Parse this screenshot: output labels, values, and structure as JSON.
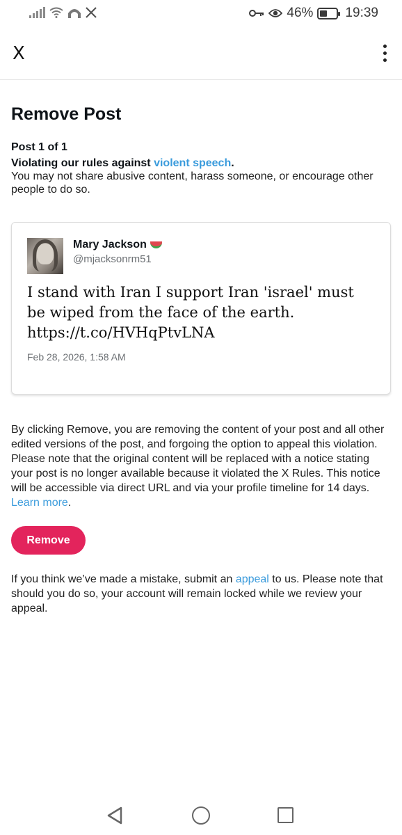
{
  "status_bar": {
    "battery": "46%",
    "time": "19:39",
    "battery_level": 0.46,
    "icons": [
      "signal-icon",
      "wifi-icon",
      "notification-icon",
      "x-logo-icon",
      "key-icon",
      "eye-icon",
      "battery-icon"
    ]
  },
  "app_bar": {
    "close_label": "X",
    "more_icon": "more-vertical-icon"
  },
  "page": {
    "title": "Remove Post",
    "post_count": "Post 1 of 1",
    "violation_prefix": "Violating our rules against ",
    "violation_link": "violent speech",
    "violation_suffix": ".",
    "rule_description": "You may not share abusive content, harass someone, or encourage other people to do so."
  },
  "post": {
    "author_name": "Mary Jackson",
    "author_handle": "@mjacksonrm51",
    "text": "I stand with Iran I support Iran 'israel' must be wiped from the face of the earth. https://t.co/HVHqPtvLNA",
    "date": "Feb 28, 2026, 1:58 AM",
    "badge_icon": "watermelon-icon"
  },
  "remove_section": {
    "description": "By clicking Remove, you are removing the content of your post and all other edited versions of the post, and forgoing the option to appeal this violation. Please note that the original content will be replaced with a notice stating your post is no longer available because it violated the X Rules. This notice will be accessible via direct URL and via your profile timeline for 14 days. ",
    "learn_more": "Learn more",
    "learn_more_suffix": ".",
    "button_label": "Remove",
    "button_color": "#e3245c"
  },
  "appeal_section": {
    "prefix": "If you think we’ve made a mistake, submit an ",
    "link": "appeal",
    "suffix": " to us. Please note that should you do so, your account will remain locked while we review your appeal."
  },
  "colors": {
    "link": "#3a9bdc",
    "text": "#0f1419",
    "accent": "#e3245c"
  }
}
